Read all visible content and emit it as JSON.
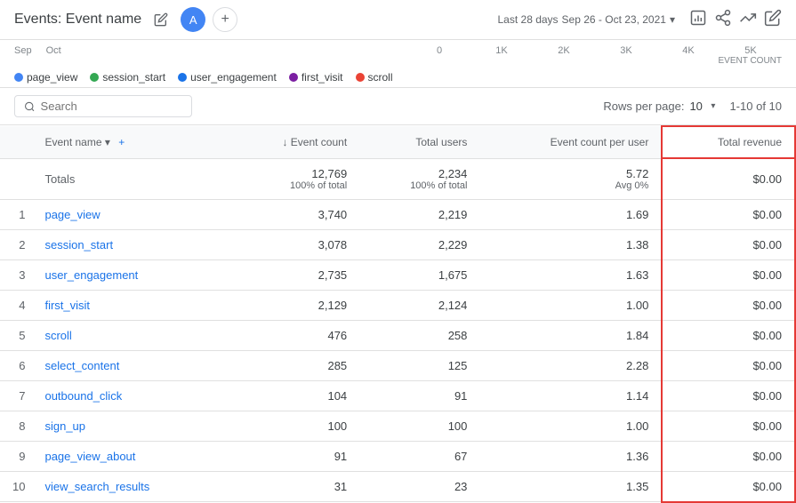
{
  "header": {
    "title": "Events: Event name",
    "avatar_label": "A",
    "date_range_label": "Last 28 days",
    "date_range_value": "Sep 26 - Oct 23, 2021",
    "date_range_icon": "▾"
  },
  "legend": {
    "items": [
      {
        "name": "page_view",
        "color": "#4285f4"
      },
      {
        "name": "session_start",
        "color": "#34a853"
      },
      {
        "name": "user_engagement",
        "color": "#1a73e8"
      },
      {
        "name": "first_visit",
        "color": "#7b1fa2"
      },
      {
        "name": "scroll",
        "color": "#ea4335"
      }
    ]
  },
  "axis": {
    "labels": [
      "0",
      "1K",
      "2K",
      "3K",
      "4K",
      "5K"
    ],
    "title": "EVENT COUNT"
  },
  "search": {
    "placeholder": "Search"
  },
  "pagination": {
    "rows_label": "Rows per page:",
    "rows_value": "10",
    "range": "1-10 of 10"
  },
  "table": {
    "columns": [
      {
        "key": "num",
        "label": ""
      },
      {
        "key": "event_name",
        "label": "Event name",
        "sortable": true
      },
      {
        "key": "event_count",
        "label": "↓ Event count",
        "sortable": false
      },
      {
        "key": "total_users",
        "label": "Total users"
      },
      {
        "key": "event_count_per_user",
        "label": "Event count per user"
      },
      {
        "key": "total_revenue",
        "label": "Total revenue"
      }
    ],
    "totals": {
      "label": "Totals",
      "event_count": "12,769",
      "event_count_sub": "100% of total",
      "total_users": "2,234",
      "total_users_sub": "100% of total",
      "event_count_per_user": "5.72",
      "event_count_per_user_sub": "Avg 0%",
      "total_revenue": "$0.00"
    },
    "rows": [
      {
        "num": 1,
        "event_name": "page_view",
        "event_count": "3,740",
        "total_users": "2,219",
        "event_count_per_user": "1.69",
        "total_revenue": "$0.00"
      },
      {
        "num": 2,
        "event_name": "session_start",
        "event_count": "3,078",
        "total_users": "2,229",
        "event_count_per_user": "1.38",
        "total_revenue": "$0.00"
      },
      {
        "num": 3,
        "event_name": "user_engagement",
        "event_count": "2,735",
        "total_users": "1,675",
        "event_count_per_user": "1.63",
        "total_revenue": "$0.00"
      },
      {
        "num": 4,
        "event_name": "first_visit",
        "event_count": "2,129",
        "total_users": "2,124",
        "event_count_per_user": "1.00",
        "total_revenue": "$0.00"
      },
      {
        "num": 5,
        "event_name": "scroll",
        "event_count": "476",
        "total_users": "258",
        "event_count_per_user": "1.84",
        "total_revenue": "$0.00"
      },
      {
        "num": 6,
        "event_name": "select_content",
        "event_count": "285",
        "total_users": "125",
        "event_count_per_user": "2.28",
        "total_revenue": "$0.00"
      },
      {
        "num": 7,
        "event_name": "outbound_click",
        "event_count": "104",
        "total_users": "91",
        "event_count_per_user": "1.14",
        "total_revenue": "$0.00"
      },
      {
        "num": 8,
        "event_name": "sign_up",
        "event_count": "100",
        "total_users": "100",
        "event_count_per_user": "1.00",
        "total_revenue": "$0.00"
      },
      {
        "num": 9,
        "event_name": "page_view_about",
        "event_count": "91",
        "total_users": "67",
        "event_count_per_user": "1.36",
        "total_revenue": "$0.00"
      },
      {
        "num": 10,
        "event_name": "view_search_results",
        "event_count": "31",
        "total_users": "23",
        "event_count_per_user": "1.35",
        "total_revenue": "$0.00"
      }
    ]
  }
}
